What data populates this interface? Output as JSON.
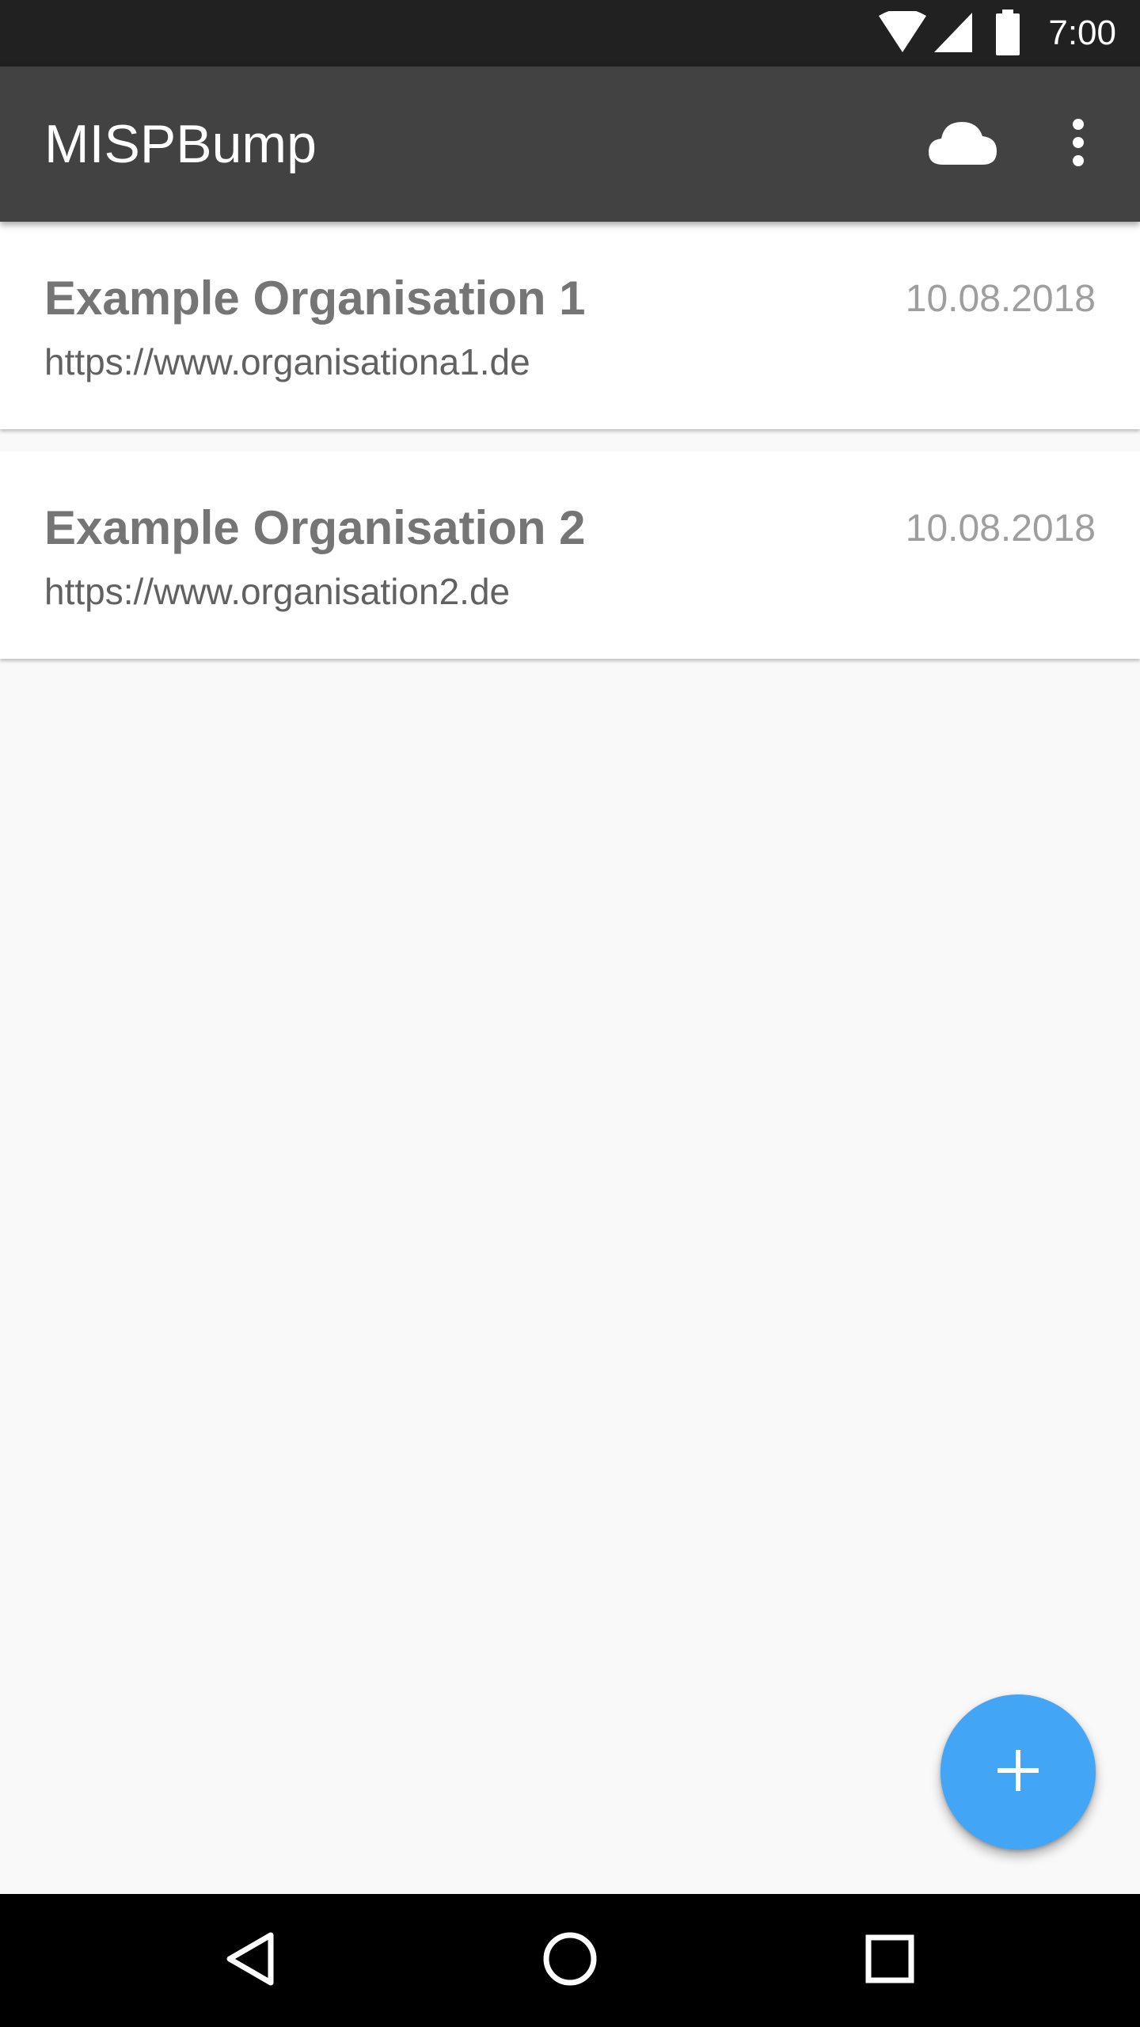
{
  "status_bar": {
    "time": "7:00",
    "icons": [
      "wifi-icon",
      "signal-icon",
      "battery-icon"
    ]
  },
  "app_bar": {
    "title": "MISPBump",
    "actions": [
      "cloud-icon",
      "more-vert-icon"
    ]
  },
  "organisations": [
    {
      "name": "Example Organisation 1",
      "url": "https://www.organisationa1.de",
      "date": "10.08.2018"
    },
    {
      "name": "Example Organisation 2",
      "url": "https://www.organisation2.de",
      "date": "10.08.2018"
    }
  ],
  "fab": {
    "icon": "add-icon"
  },
  "navigation": {
    "buttons": [
      "back-icon",
      "home-icon",
      "recents-icon"
    ]
  },
  "colors": {
    "status_bar": "#212121",
    "app_bar": "#424242",
    "background": "#f9f9f9",
    "fab": "#42a5f5",
    "title_text": "#757575",
    "date_text": "#9e9e9e"
  }
}
